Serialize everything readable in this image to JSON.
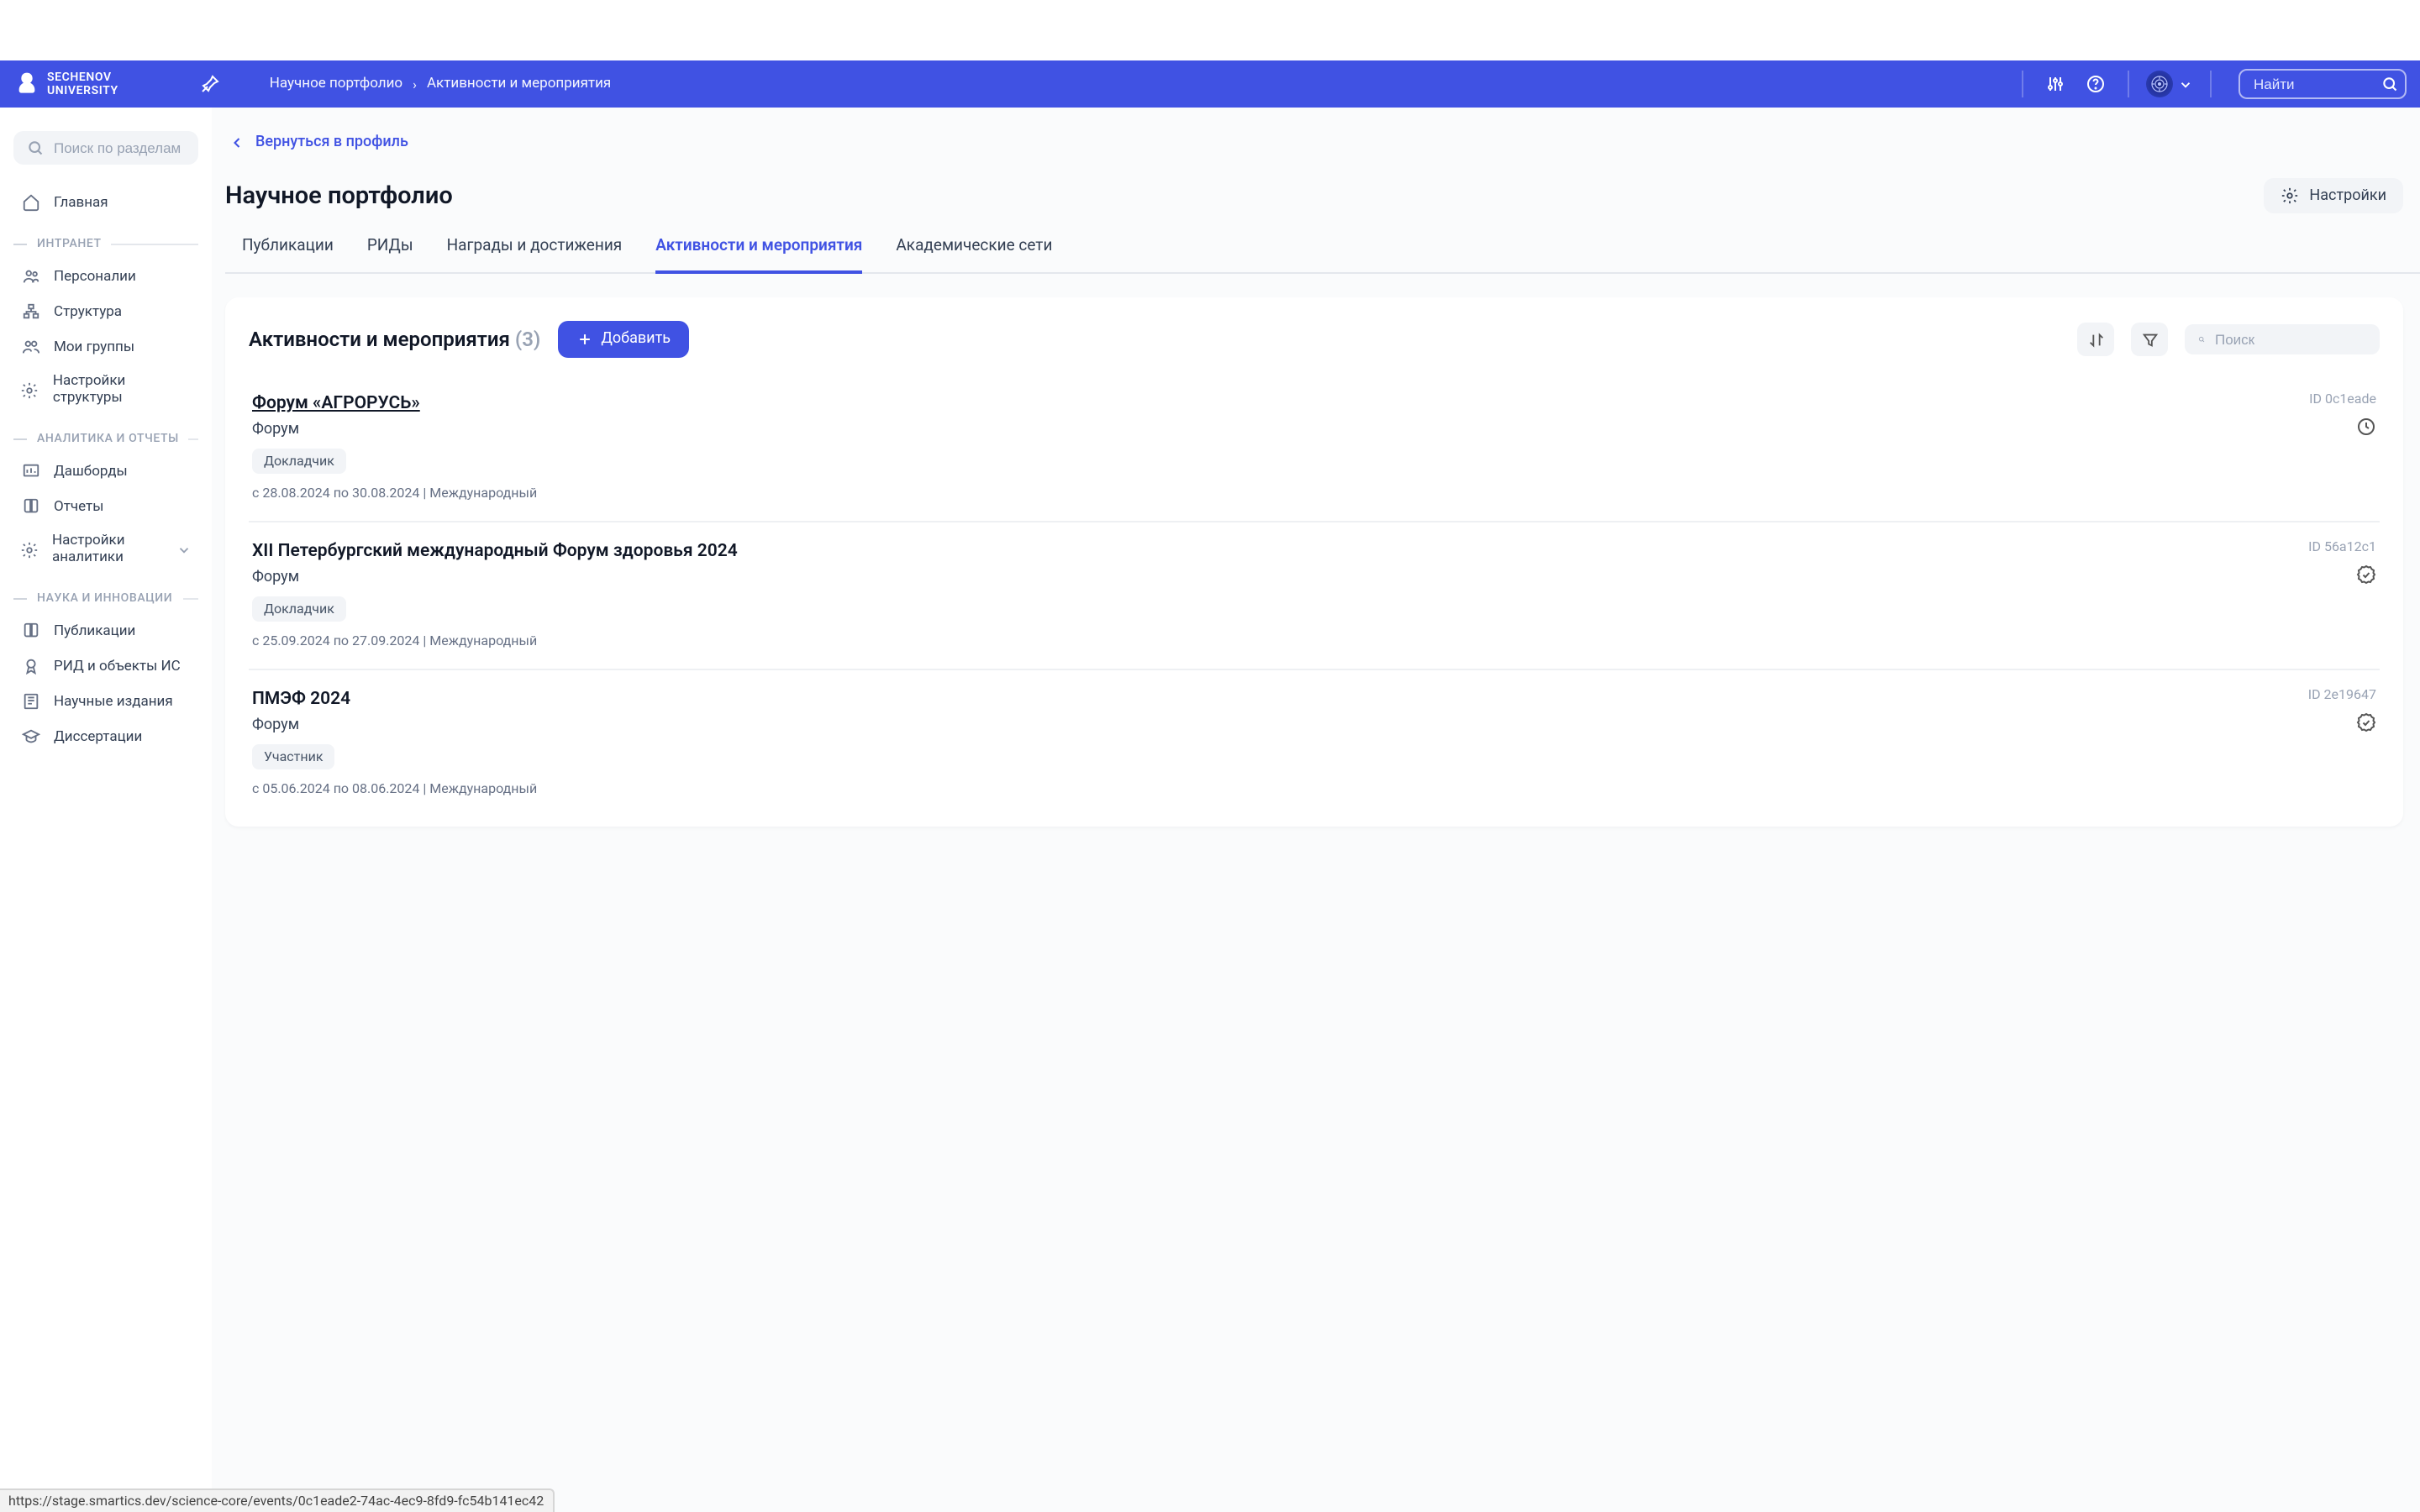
{
  "header": {
    "logo_line1": "SECHENOV",
    "logo_line2": "UNIVERSITY",
    "breadcrumb": [
      "Научное портфолио",
      "Активности и мероприятия"
    ],
    "search_placeholder": "Найти"
  },
  "sidebar": {
    "search_placeholder": "Поиск по разделам",
    "home": "Главная",
    "sections": [
      {
        "label": "ИНТРАНЕТ",
        "items": [
          "Персоналии",
          "Структура",
          "Мои группы",
          "Настройки структуры"
        ]
      },
      {
        "label": "АНАЛИТИКА И ОТЧЕТЫ",
        "items": [
          "Дашборды",
          "Отчеты",
          "Настройки аналитики"
        ]
      },
      {
        "label": "НАУКА И ИННОВАЦИИ",
        "items": [
          "Публикации",
          "РИД и объекты ИС",
          "Научные издания",
          "Диссертации"
        ]
      }
    ]
  },
  "main": {
    "backlink": "Вернуться в профиль",
    "title": "Научное портфолио",
    "settings": "Настройки",
    "tabs": [
      "Публикации",
      "РИДы",
      "Награды и достижения",
      "Активности и мероприятия",
      "Академические сети"
    ],
    "active_tab": 3,
    "panel": {
      "title": "Активности и мероприятия",
      "count": "(3)",
      "add": "Добавить",
      "search_placeholder": "Поиск"
    },
    "events": [
      {
        "title": "Форум «АГРОРУСЬ»",
        "underlined": true,
        "id": "ID 0c1eade",
        "type": "Форум",
        "role": "Докладчик",
        "meta": "с 28.08.2024 по 30.08.2024 | Международный",
        "status": "pending"
      },
      {
        "title": "XII Петербургский международный Форум здоровья 2024",
        "underlined": false,
        "id": "ID 56a12c1",
        "type": "Форум",
        "role": "Докладчик",
        "meta": "с 25.09.2024 по 27.09.2024 | Международный",
        "status": "verified"
      },
      {
        "title": "ПМЭФ 2024",
        "underlined": false,
        "id": "ID 2e19647",
        "type": "Форум",
        "role": "Участник",
        "meta": "с 05.06.2024 по 08.06.2024 | Международный",
        "status": "verified"
      }
    ]
  },
  "status_url": "https://stage.smartics.dev/science-core/events/0c1eade2-74ac-4ec9-8fd9-fc54b141ec42"
}
